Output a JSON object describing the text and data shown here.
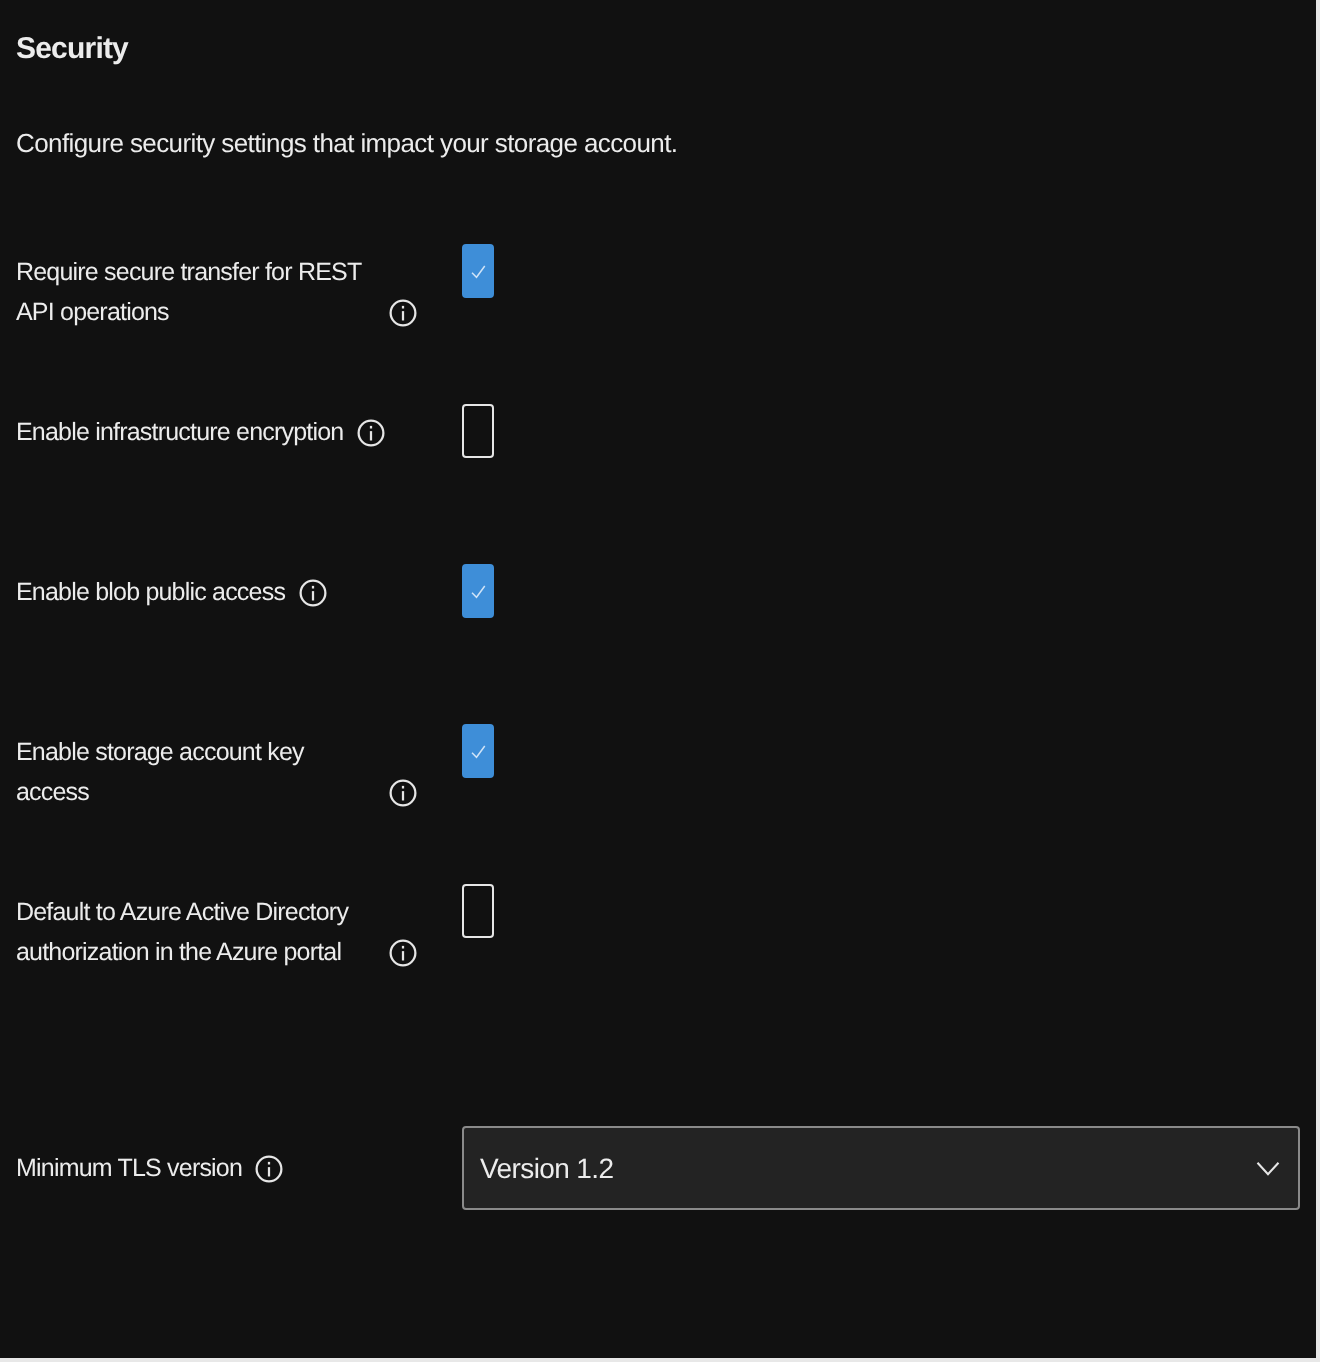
{
  "section": {
    "title": "Security",
    "description": "Configure security settings that impact your storage account."
  },
  "settings": [
    {
      "kind": "checkbox",
      "label": "Require secure transfer for REST API operations",
      "checked": true
    },
    {
      "kind": "checkbox",
      "label": "Enable infrastructure encryption",
      "checked": false
    },
    {
      "kind": "checkbox",
      "label": "Enable blob public access",
      "checked": true
    },
    {
      "kind": "checkbox",
      "label": "Enable storage account key access",
      "checked": true
    },
    {
      "kind": "checkbox",
      "label": "Default to Azure Active Directory authorization in the Azure portal",
      "checked": false
    },
    {
      "kind": "dropdown",
      "label": "Minimum TLS version",
      "value": "Version 1.2"
    }
  ]
}
